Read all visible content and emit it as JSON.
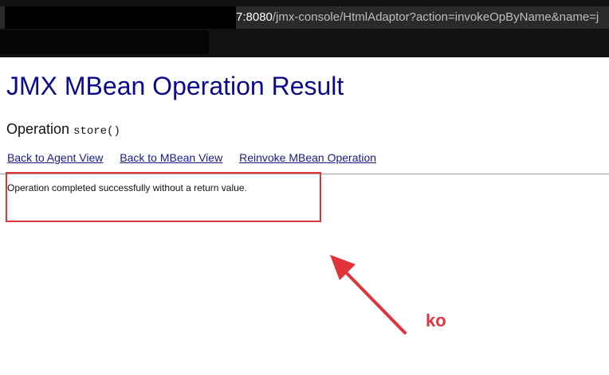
{
  "browser": {
    "address_bar": {
      "host_suffix": "7:8080",
      "path": "/jmx-console/HtmlAdaptor?action=invokeOpByName&name=j"
    }
  },
  "page": {
    "title": "JMX MBean Operation Result",
    "operation_label": "Operation",
    "operation_name": "store()",
    "links": {
      "agent_view": "Back to Agent View",
      "mbean_view": "Back to MBean View",
      "reinvoke": "Reinvoke MBean Operation"
    },
    "result_message": "Operation completed successfully without a return value."
  },
  "annotation": {
    "label": "ko",
    "color": "#e0343a"
  },
  "colors": {
    "title": "#0a0a8c",
    "link": "#1a1a8c",
    "chrome": "#111111"
  }
}
